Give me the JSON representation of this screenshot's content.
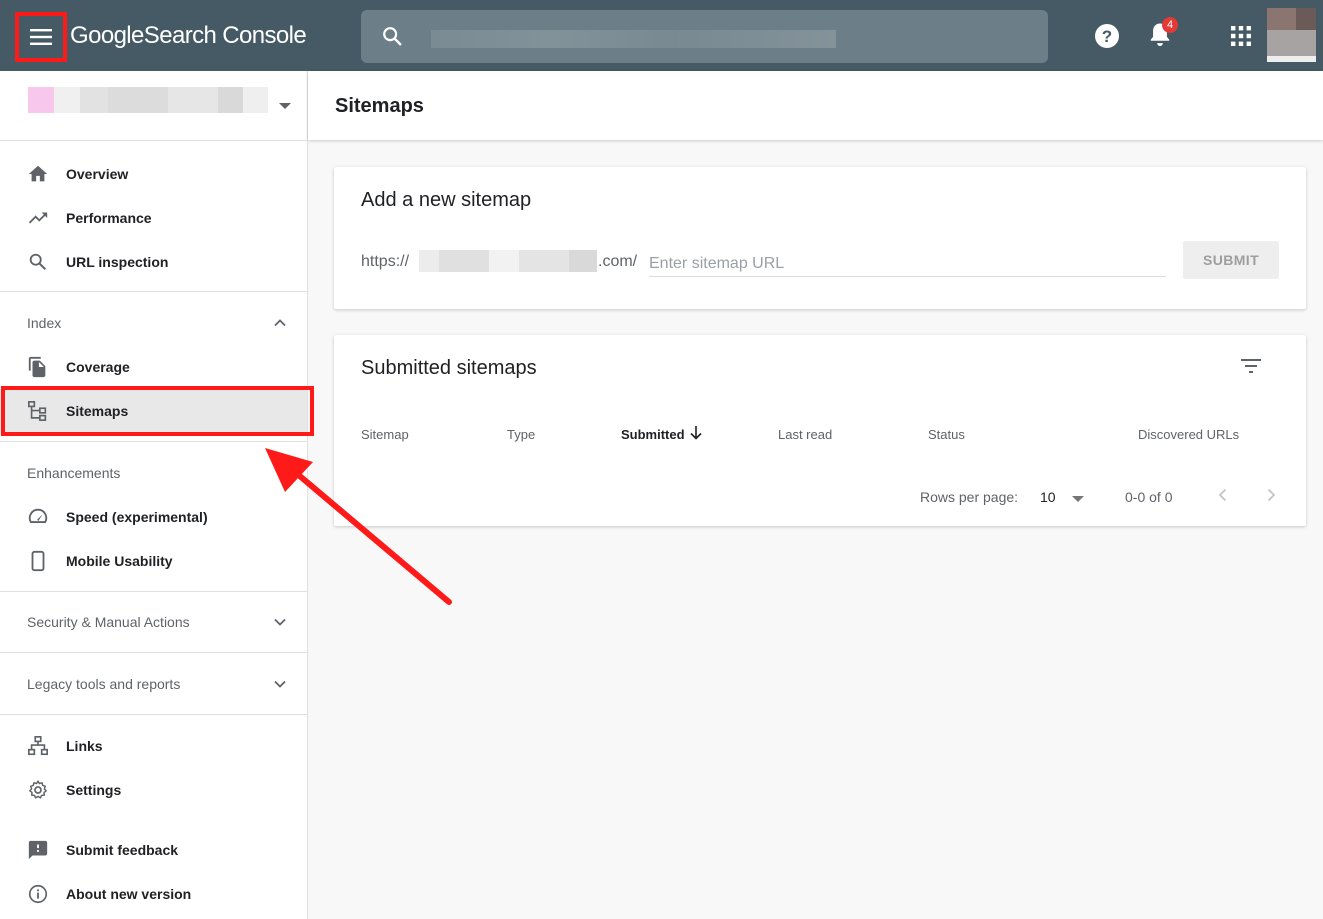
{
  "app": {
    "logo_google": "Google",
    "logo_product": "Search Console",
    "notification_count": "4"
  },
  "colors": {
    "topbar": "#455a64",
    "annotation_red": "#ff1a1a",
    "badge": "#e53935"
  },
  "icons": {
    "menu": "menu-icon",
    "search": "search-icon",
    "help": "help-icon",
    "notifications": "bell-icon",
    "apps": "apps-grid-icon"
  },
  "sidebar": {
    "primary": [
      {
        "label": "Overview",
        "icon": "home-icon"
      },
      {
        "label": "Performance",
        "icon": "trending-up-icon"
      },
      {
        "label": "URL inspection",
        "icon": "search-icon"
      }
    ],
    "index": {
      "title": "Index",
      "items": [
        {
          "label": "Coverage",
          "icon": "coverage-icon"
        },
        {
          "label": "Sitemaps",
          "icon": "sitemap-icon",
          "selected": true
        }
      ]
    },
    "enhancements": {
      "title": "Enhancements",
      "items": [
        {
          "label": "Speed (experimental)",
          "icon": "speed-icon"
        },
        {
          "label": "Mobile Usability",
          "icon": "smartphone-icon"
        }
      ]
    },
    "security": {
      "title": "Security & Manual Actions"
    },
    "legacy": {
      "title": "Legacy tools and reports"
    },
    "tools": [
      {
        "label": "Links",
        "icon": "links-icon"
      },
      {
        "label": "Settings",
        "icon": "gear-icon"
      }
    ],
    "footer": [
      {
        "label": "Submit feedback",
        "icon": "feedback-icon"
      },
      {
        "label": "About new version",
        "icon": "info-icon"
      }
    ]
  },
  "main": {
    "page_title": "Sitemaps",
    "add_card": {
      "title": "Add a new sitemap",
      "url_prefix": "https://",
      "url_suffix": ".com/",
      "input_value": "",
      "input_placeholder": "Enter sitemap URL",
      "submit_label": "SUBMIT"
    },
    "submitted_card": {
      "title": "Submitted sitemaps",
      "columns": [
        "Sitemap",
        "Type",
        "Submitted",
        "Last read",
        "Status",
        "Discovered URLs"
      ],
      "sorted_column": "Submitted",
      "rows": [],
      "pagination": {
        "rows_per_page_label": "Rows per page:",
        "rows_per_page_value": "10",
        "range": "0-0 of 0"
      }
    }
  }
}
